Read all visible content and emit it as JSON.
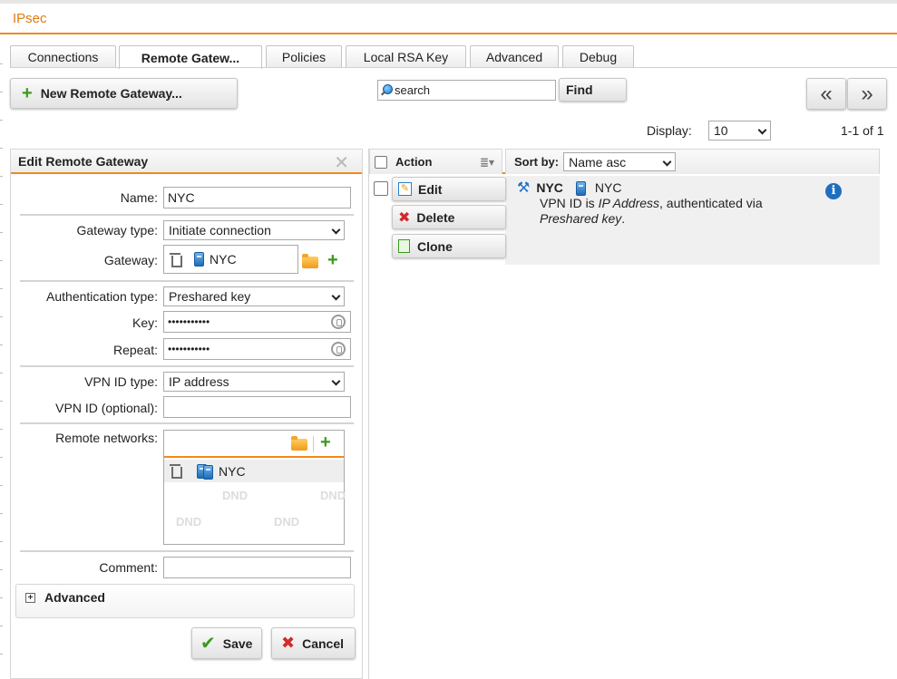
{
  "app": {
    "title": "IPsec"
  },
  "tabs": [
    {
      "label": "Connections"
    },
    {
      "label": "Remote Gatew..."
    },
    {
      "label": "Policies"
    },
    {
      "label": "Local RSA Key"
    },
    {
      "label": "Advanced"
    },
    {
      "label": "Debug"
    }
  ],
  "toolbar": {
    "new_label": "New Remote Gateway...",
    "search_placeholder": "search",
    "find_label": "Find",
    "prev_label": "«",
    "next_label": "»",
    "display_label": "Display:",
    "display_value": "10",
    "range_text": "1-1 of 1"
  },
  "edit_panel": {
    "title": "Edit Remote Gateway",
    "close_label": "✕",
    "name_label": "Name:",
    "name_value": "NYC",
    "gateway_type_label": "Gateway type:",
    "gateway_type_value": "Initiate connection",
    "gateway_label": "Gateway:",
    "gateway_value": "NYC",
    "auth_type_label": "Authentication type:",
    "auth_type_value": "Preshared key",
    "key_label": "Key:",
    "key_value": "•••••••••••",
    "repeat_label": "Repeat:",
    "repeat_value": "•••••••••••",
    "vpn_id_type_label": "VPN ID type:",
    "vpn_id_type_value": "IP address",
    "vpn_id_label": "VPN ID (optional):",
    "vpn_id_value": "",
    "remote_networks_label": "Remote networks:",
    "remote_networks": [
      {
        "name": "NYC"
      }
    ],
    "dnd_label": "DND",
    "comment_label": "Comment:",
    "comment_value": "",
    "advanced_label": "Advanced",
    "save_label": "Save",
    "cancel_label": "Cancel"
  },
  "list": {
    "action_header": "Action",
    "sortby_label": "Sort by:",
    "sortby_value": "Name asc",
    "rows": [
      {
        "name": "NYC",
        "gateway": "NYC",
        "desc_prefix": "VPN ID is ",
        "desc_em1": "IP Address",
        "desc_mid": ", authenticated via",
        "desc_em2": "Preshared key",
        "desc_end": ".",
        "actions": {
          "edit": "Edit",
          "delete": "Delete",
          "clone": "Clone"
        }
      }
    ]
  },
  "colors": {
    "accent": "#f08a1c",
    "title": "#e07b10",
    "plus": "#3a9b1c",
    "delete": "#d12b2b",
    "info": "#1f6fc0"
  }
}
